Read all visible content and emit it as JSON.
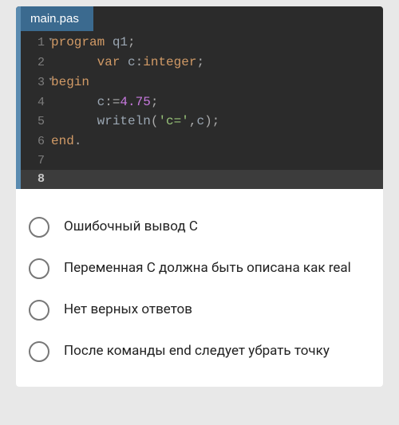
{
  "editor": {
    "filename": "main.pas",
    "lines": [
      {
        "n": "1",
        "fold": true,
        "tokens": [
          [
            "kw",
            "program"
          ],
          [
            "punct",
            " "
          ],
          [
            "ident",
            "q1"
          ],
          [
            "punct",
            ";"
          ]
        ]
      },
      {
        "n": "2",
        "fold": false,
        "tokens": [
          [
            "punct",
            "      "
          ],
          [
            "kw",
            "var"
          ],
          [
            "punct",
            " "
          ],
          [
            "ident",
            "c"
          ],
          [
            "punct",
            ":"
          ],
          [
            "kw",
            "integer"
          ],
          [
            "punct",
            ";"
          ]
        ]
      },
      {
        "n": "3",
        "fold": true,
        "tokens": [
          [
            "kw",
            "begin"
          ]
        ]
      },
      {
        "n": "4",
        "fold": false,
        "tokens": [
          [
            "punct",
            "      "
          ],
          [
            "ident",
            "c"
          ],
          [
            "punct",
            ":="
          ],
          [
            "num",
            "4.75"
          ],
          [
            "punct",
            ";"
          ]
        ]
      },
      {
        "n": "5",
        "fold": false,
        "tokens": [
          [
            "punct",
            "      "
          ],
          [
            "ident",
            "writeln"
          ],
          [
            "punct",
            "("
          ],
          [
            "str",
            "'c='"
          ],
          [
            "punct",
            ","
          ],
          [
            "ident",
            "c"
          ],
          [
            "punct",
            ");"
          ]
        ]
      },
      {
        "n": "6",
        "fold": false,
        "tokens": [
          [
            "kw",
            "end"
          ],
          [
            "punct",
            "."
          ]
        ]
      },
      {
        "n": "7",
        "fold": false,
        "tokens": []
      },
      {
        "n": "8",
        "fold": false,
        "tokens": [],
        "highlight": true
      }
    ]
  },
  "options": [
    "Ошибочный вывод С",
    "Переменная С должна быть описана как real",
    "Нет верных ответов",
    "После команды end следует убрать точку"
  ]
}
